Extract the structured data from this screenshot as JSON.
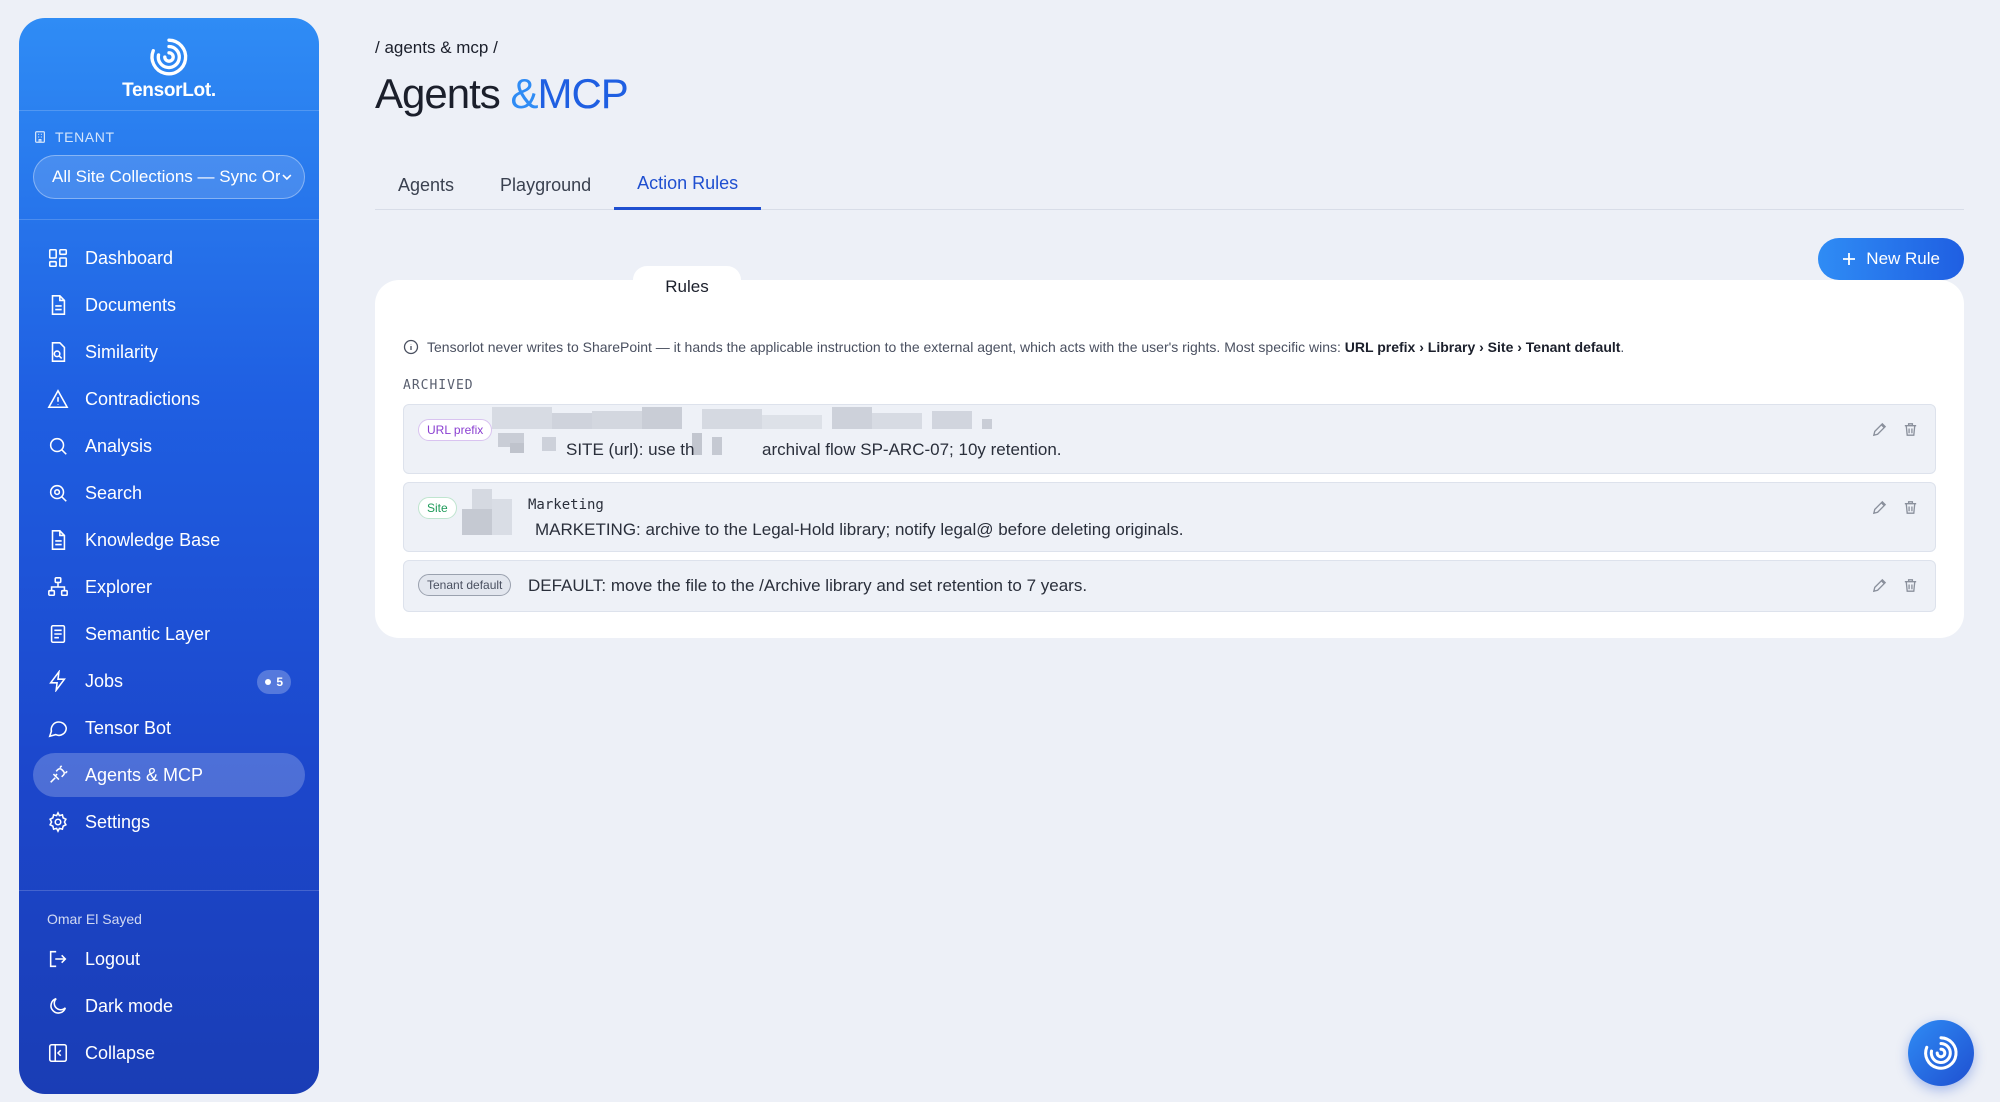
{
  "app": {
    "brand": "TensorLot."
  },
  "tenant": {
    "label": "TENANT",
    "selected": "All Site Collections — Sync Or"
  },
  "nav": [
    {
      "label": "Dashboard",
      "icon": "dashboard-icon"
    },
    {
      "label": "Documents",
      "icon": "document-icon"
    },
    {
      "label": "Similarity",
      "icon": "similarity-icon"
    },
    {
      "label": "Contradictions",
      "icon": "warning-icon"
    },
    {
      "label": "Analysis",
      "icon": "search-icon"
    },
    {
      "label": "Search",
      "icon": "search-plus-icon"
    },
    {
      "label": "Knowledge Base",
      "icon": "document-icon"
    },
    {
      "label": "Explorer",
      "icon": "hierarchy-icon"
    },
    {
      "label": "Semantic Layer",
      "icon": "layers-icon"
    },
    {
      "label": "Jobs",
      "icon": "bolt-icon",
      "badge": "5"
    },
    {
      "label": "Tensor Bot",
      "icon": "chat-icon"
    },
    {
      "label": "Agents & MCP",
      "icon": "plug-icon",
      "active": true
    },
    {
      "label": "Settings",
      "icon": "gear-icon"
    }
  ],
  "user": {
    "name": "Omar El Sayed",
    "logout": "Logout",
    "dark_mode": "Dark mode",
    "collapse": "Collapse"
  },
  "page": {
    "breadcrumb": "/ agents & mcp /",
    "title_part1": "Agents",
    "title_amp": "&",
    "title_part2": "MCP"
  },
  "tabs": [
    {
      "label": "Agents"
    },
    {
      "label": "Playground"
    },
    {
      "label": "Action Rules",
      "active": true
    }
  ],
  "actions": {
    "new_rule": "New Rule"
  },
  "rules_card": {
    "tab_label": "Rules",
    "info_text": "Tensorlot never writes to SharePoint — it hands the applicable instruction to the external agent, which acts with the user's rights. Most specific wins:",
    "info_bold": "URL prefix › Library › Site › Tenant default",
    "info_end": ".",
    "group_label": "ARCHIVED",
    "rules": [
      {
        "scope": "URL prefix",
        "target": "",
        "text_a": "SITE (url): use th",
        "text_b": "archival flow SP-ARC-07; 10y retention."
      },
      {
        "scope": "Site",
        "target": "Marketing",
        "text": "MARKETING: archive to the Legal-Hold library; notify legal@ before deleting originals."
      },
      {
        "scope": "Tenant default",
        "text": "DEFAULT: move the file to the /Archive library and set retention to 7 years."
      }
    ]
  },
  "colors": {
    "accent": "#1f4fd0",
    "sidebar_top": "#2f8cf5",
    "sidebar_bottom": "#1a3db5",
    "background": "#edf0f7"
  }
}
